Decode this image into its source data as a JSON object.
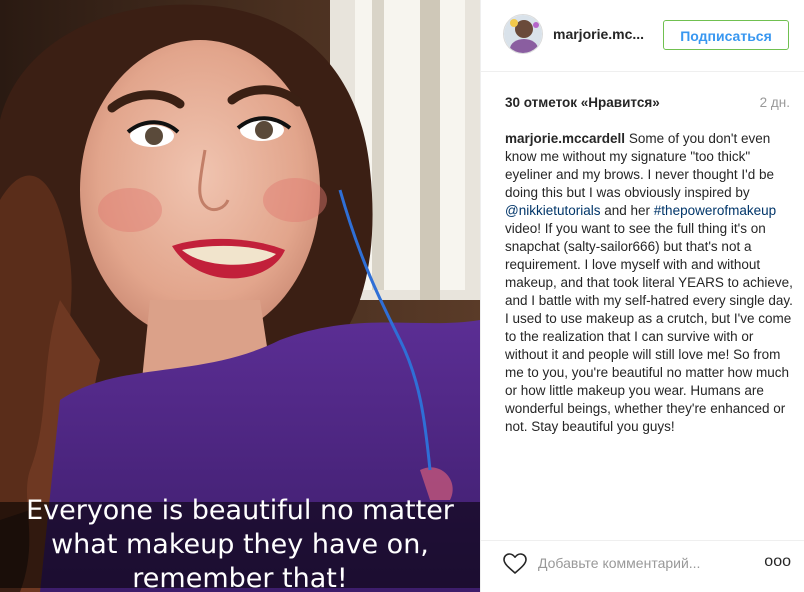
{
  "photo": {
    "caption": "Everyone is beautiful no matter what makeup they have on, remember that!"
  },
  "header": {
    "username": "marjorie.mc...",
    "follow_label": "Подписаться"
  },
  "post": {
    "likes_text": "30 отметок «Нравится»",
    "time_ago": "2 дн.",
    "comment": {
      "author": "marjorie.mccardell",
      "text_part1": " Some of you don't even know me without my signature \"too thick\" eyeliner and my brows. I never thought I'd be doing this but I was obviously inspired by ",
      "mention": "@nikkietutorials",
      "text_part2": " and her ",
      "hashtag": "#thepowerofmakeup",
      "text_part3": " video! If you want to see the full thing it's on snapchat (salty-sailor666) but that's not a requirement. I love myself with and without makeup, and that took literal YEARS to achieve, and I battle with my self-hatred every single day. I used to use makeup as a crutch, but I've come to the realization that I can survive with or without it and people will still love me! So from me to you, you're beautiful no matter how much or how little makeup you wear. Humans are wonderful beings, whether they're enhanced or not. Stay beautiful you guys!"
    }
  },
  "footer": {
    "add_comment_placeholder": "Добавьте комментарий...",
    "more_label": "ooo",
    "like_icon": "heart-outline-icon"
  },
  "colors": {
    "link": "#003569",
    "follow_text": "#3897f0",
    "follow_border": "#70c050",
    "muted": "#999999"
  }
}
